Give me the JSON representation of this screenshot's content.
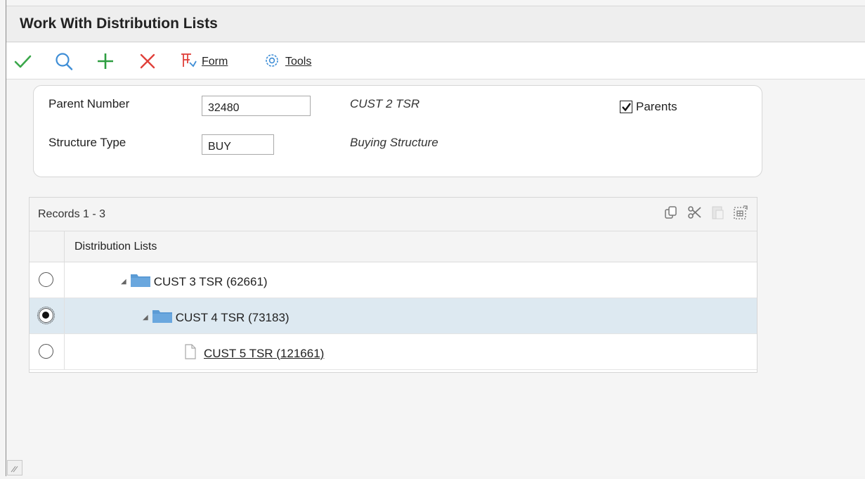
{
  "window": {
    "title": "Work With Distribution Lists"
  },
  "toolbar": {
    "ok_icon": "checkmark-icon",
    "find_icon": "search-icon",
    "add_icon": "plus-icon",
    "close_icon": "x-close-icon",
    "form_icon": "form-exit-icon",
    "form_label": "Form",
    "tools_icon": "gear-icon",
    "tools_label": "Tools",
    "colors": {
      "ok": "#3aa74a",
      "find": "#3f8ed6",
      "add": "#2e9e41",
      "close": "#e0403a",
      "form": "#e0403a",
      "tools": "#3f8ed6"
    }
  },
  "header": {
    "parent_number_label": "Parent Number",
    "parent_number_value": "32480",
    "parent_number_desc": "CUST 2 TSR",
    "structure_type_label": "Structure Type",
    "structure_type_value": "BUY",
    "structure_type_desc": "Buying Structure",
    "parents_label": "Parents",
    "parents_checked": true
  },
  "grid": {
    "records_text": "Records 1 - 3",
    "tool_icons": [
      "copy-icon",
      "cut-icon",
      "paste-icon",
      "export-icon"
    ],
    "column_header": "Distribution Lists",
    "rows": [
      {
        "label": "CUST 3 TSR (62661)",
        "selected": false,
        "level": 1,
        "type": "folder",
        "expanded": true,
        "link": false
      },
      {
        "label": "CUST 4 TSR (73183)",
        "selected": true,
        "level": 2,
        "type": "folder",
        "expanded": true,
        "link": false
      },
      {
        "label": "CUST 5 TSR (121661)",
        "selected": false,
        "level": 3,
        "type": "document",
        "expanded": false,
        "link": true
      }
    ]
  },
  "colors": {
    "selected_row": "#dde9f1",
    "folder": "#5b9bd5"
  }
}
